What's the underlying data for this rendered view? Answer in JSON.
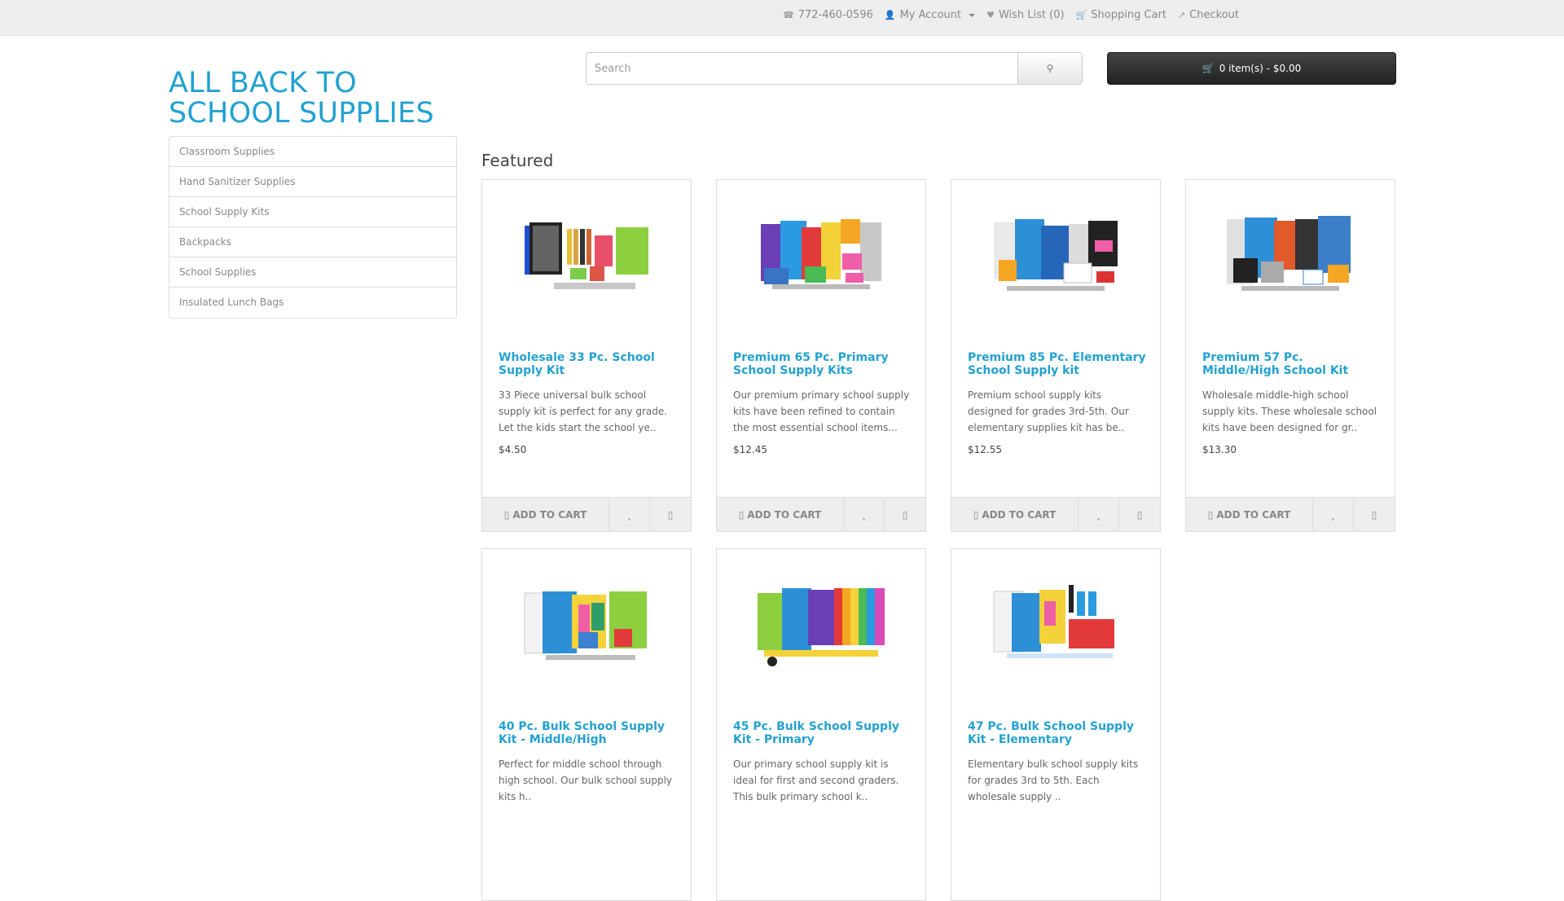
{
  "top_links": {
    "phone": "772-460-0596",
    "my_account": "My Account",
    "wish_list": "Wish List (0)",
    "shopping_cart": "Shopping Cart",
    "checkout": "Checkout"
  },
  "header": {
    "logo": "ALL BACK TO SCHOOL SUPPLIES",
    "search_placeholder": "Search",
    "cart_summary": "0 item(s) - $0.00"
  },
  "categories": [
    "Classroom Supplies",
    "Hand Sanitizer Supplies",
    "School Supply Kits",
    "Backpacks",
    "School Supplies",
    "Insulated Lunch Bags"
  ],
  "featured": {
    "title": "Featured",
    "add_to_cart_label": "ADD TO CART",
    "products": [
      {
        "name": "Wholesale 33 Pc. School Supply Kit",
        "desc": "33 Piece universal bulk school supply kit is perfect for any grade. Let the kids start the school ye..",
        "price": "$4.50"
      },
      {
        "name": "Premium 65 Pc. Primary School Supply Kits",
        "desc": "Our premium primary school supply kits have been refined to contain the most essential school items...",
        "price": "$12.45"
      },
      {
        "name": "Premium 85 Pc. Elementary School Supply kit",
        "desc": "Premium school supply kits designed for grades 3rd-5th. Our elementary supplies kit has be..",
        "price": "$12.55"
      },
      {
        "name": "Premium 57 Pc. Middle/High School Kit",
        "desc": "Wholesale middle-high school supply kits. These wholesale school kits have been designed for gr..",
        "price": "$13.30"
      },
      {
        "name": "40 Pc. Bulk School Supply Kit - Middle/High",
        "desc": "   Perfect for middle school through high school. Our bulk school supply kits h..",
        "price": ""
      },
      {
        "name": "45 Pc. Bulk School Supply Kit - Primary",
        "desc": "Our primary school supply kit is ideal for first and second graders. This bulk primary school k..",
        "price": ""
      },
      {
        "name": "47 Pc. Bulk School Supply Kit - Elementary",
        "desc": "Elementary bulk school supply kits for grades 3rd to 5th. Each wholesale supply ..",
        "price": ""
      }
    ]
  },
  "colors": {
    "accent": "#23a1d1",
    "topbar": "#eeeeee",
    "cart_button": "#303030"
  },
  "icons": [
    "phone-icon",
    "user-icon",
    "heart-icon",
    "shopping-cart-icon",
    "share-icon",
    "search-icon",
    "cart-icon",
    "exchange-icon"
  ]
}
